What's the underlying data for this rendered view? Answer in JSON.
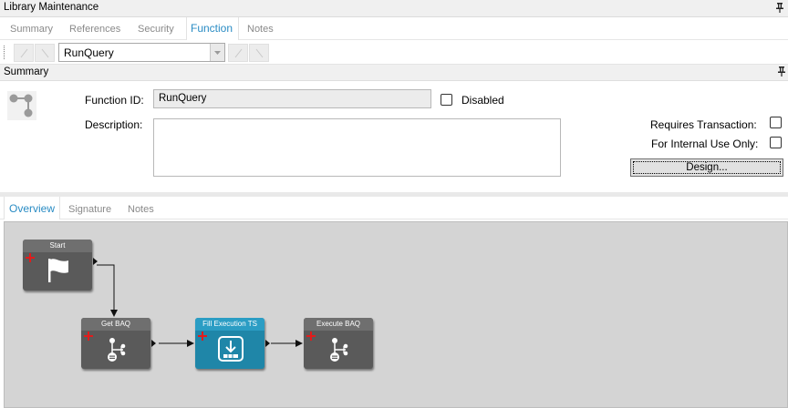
{
  "window": {
    "title": "Library Maintenance"
  },
  "main_tabs": [
    {
      "label": "Summary"
    },
    {
      "label": "References"
    },
    {
      "label": "Security"
    },
    {
      "label": "Function"
    },
    {
      "label": "Notes"
    }
  ],
  "toolbar": {
    "function_select": "RunQuery"
  },
  "summary": {
    "title": "Summary",
    "function_id_label": "Function ID:",
    "function_id_value": "RunQuery",
    "disabled_label": "Disabled",
    "description_label": "Description:",
    "description_value": "",
    "requires_transaction_label": "Requires Transaction:",
    "internal_use_label": "For Internal Use Only:",
    "design_button": "Design..."
  },
  "sub_tabs": [
    {
      "label": "Overview"
    },
    {
      "label": "Signature"
    },
    {
      "label": "Notes"
    }
  ],
  "workflow": {
    "nodes": [
      {
        "label": "Start"
      },
      {
        "label": "Get BAQ"
      },
      {
        "label": "Fill Execution TS"
      },
      {
        "label": "Execute BAQ"
      }
    ]
  },
  "colors": {
    "active_tab": "#2a8cc4",
    "node_default": "#5a5a5a",
    "node_selected": "#1f86a8",
    "canvas": "#d4d4d4"
  }
}
